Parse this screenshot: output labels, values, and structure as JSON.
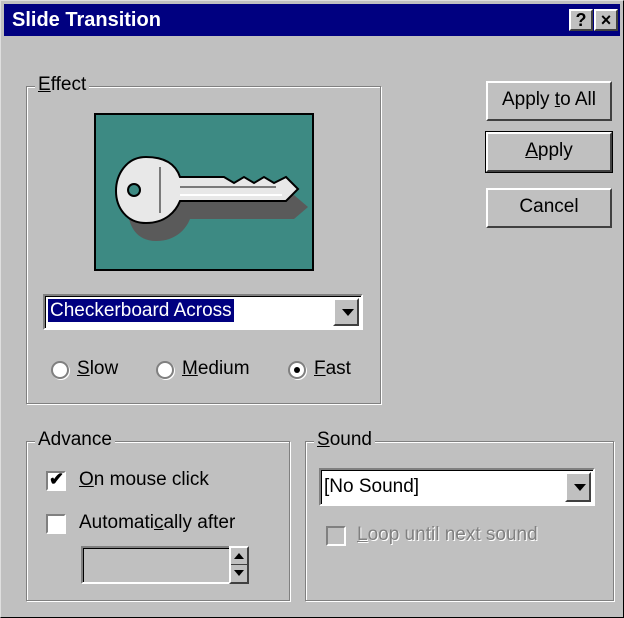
{
  "dialog": {
    "title": "Slide Transition",
    "help_button": "?",
    "close_button": "×"
  },
  "effect": {
    "legend_accel": "E",
    "legend_rest": "ffect",
    "preview_icon": "key-icon",
    "effect_selected": "Checkerboard Across",
    "speed_options": [
      {
        "accel": "S",
        "rest": "low",
        "selected": false
      },
      {
        "pre": "",
        "accel": "M",
        "rest": "edium",
        "selected": false
      },
      {
        "accel": "F",
        "rest": "ast",
        "selected": true
      }
    ]
  },
  "buttons": {
    "apply_to_all_pre": "Apply ",
    "apply_to_all_accel": "t",
    "apply_to_all_post": "o All",
    "apply_accel": "A",
    "apply_rest": "pply",
    "cancel": "Cancel"
  },
  "advance": {
    "legend": "Advance",
    "on_mouse_click_accel": "O",
    "on_mouse_click_rest": "n mouse click",
    "on_mouse_click_checked": true,
    "auto_pre": "Automati",
    "auto_accel": "c",
    "auto_post": "ally after",
    "auto_checked": false,
    "auto_value": ""
  },
  "sound": {
    "legend_accel": "S",
    "legend_rest": "ound",
    "selected": "[No Sound]",
    "loop_accel": "L",
    "loop_rest": "oop until next sound",
    "loop_checked": false,
    "loop_enabled": false
  },
  "colors": {
    "titlebar": "#000080",
    "dialog_face": "#c0c0c0",
    "preview_bg": "#3d8a83",
    "selection": "#000080"
  }
}
